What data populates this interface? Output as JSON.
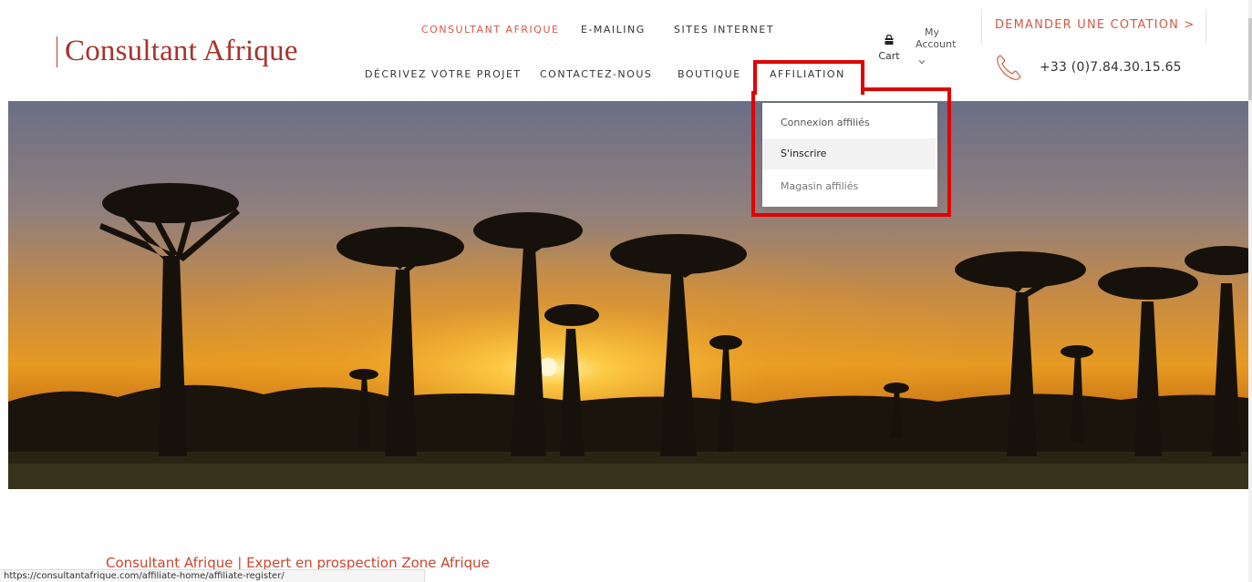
{
  "logo": {
    "text": "Consultant Afrique"
  },
  "nav": {
    "top": [
      {
        "label": "CONSULTANT AFRIQUE",
        "accent": true
      },
      {
        "label": "E-MAILING"
      },
      {
        "label": "SITES INTERNET"
      }
    ],
    "bottom": [
      {
        "label": "DÉCRIVEZ VOTRE PROJET"
      },
      {
        "label": "CONTACTEZ-NOUS"
      },
      {
        "label": "BOUTIQUE"
      },
      {
        "label": "AFFILIATION"
      }
    ]
  },
  "cart": {
    "label": "Cart",
    "icon": "shopping-bag-icon"
  },
  "account": {
    "line1": "My",
    "line2": "Account",
    "icon": "chevron-down-icon"
  },
  "quote": {
    "label": "DEMANDER UNE COTATION >"
  },
  "phone": {
    "number": "+33 (0)7.84.30.15.65",
    "icon": "phone-icon"
  },
  "dropdown": {
    "items": [
      {
        "label": "Connexion affiliés"
      },
      {
        "label": "S'inscrire"
      },
      {
        "label": "Magasin affiliés"
      }
    ]
  },
  "hero": {
    "icon": "baobab-sunset-image"
  },
  "content": {
    "subtitle": "Consultant Afrique | Expert en prospection Zone Afrique"
  },
  "status": {
    "url": "https://consultantafrique.com/affiliate-home/affiliate-register/"
  },
  "colors": {
    "accent": "#d25a44",
    "brand": "#a8332c",
    "highlight": "#e10000"
  }
}
